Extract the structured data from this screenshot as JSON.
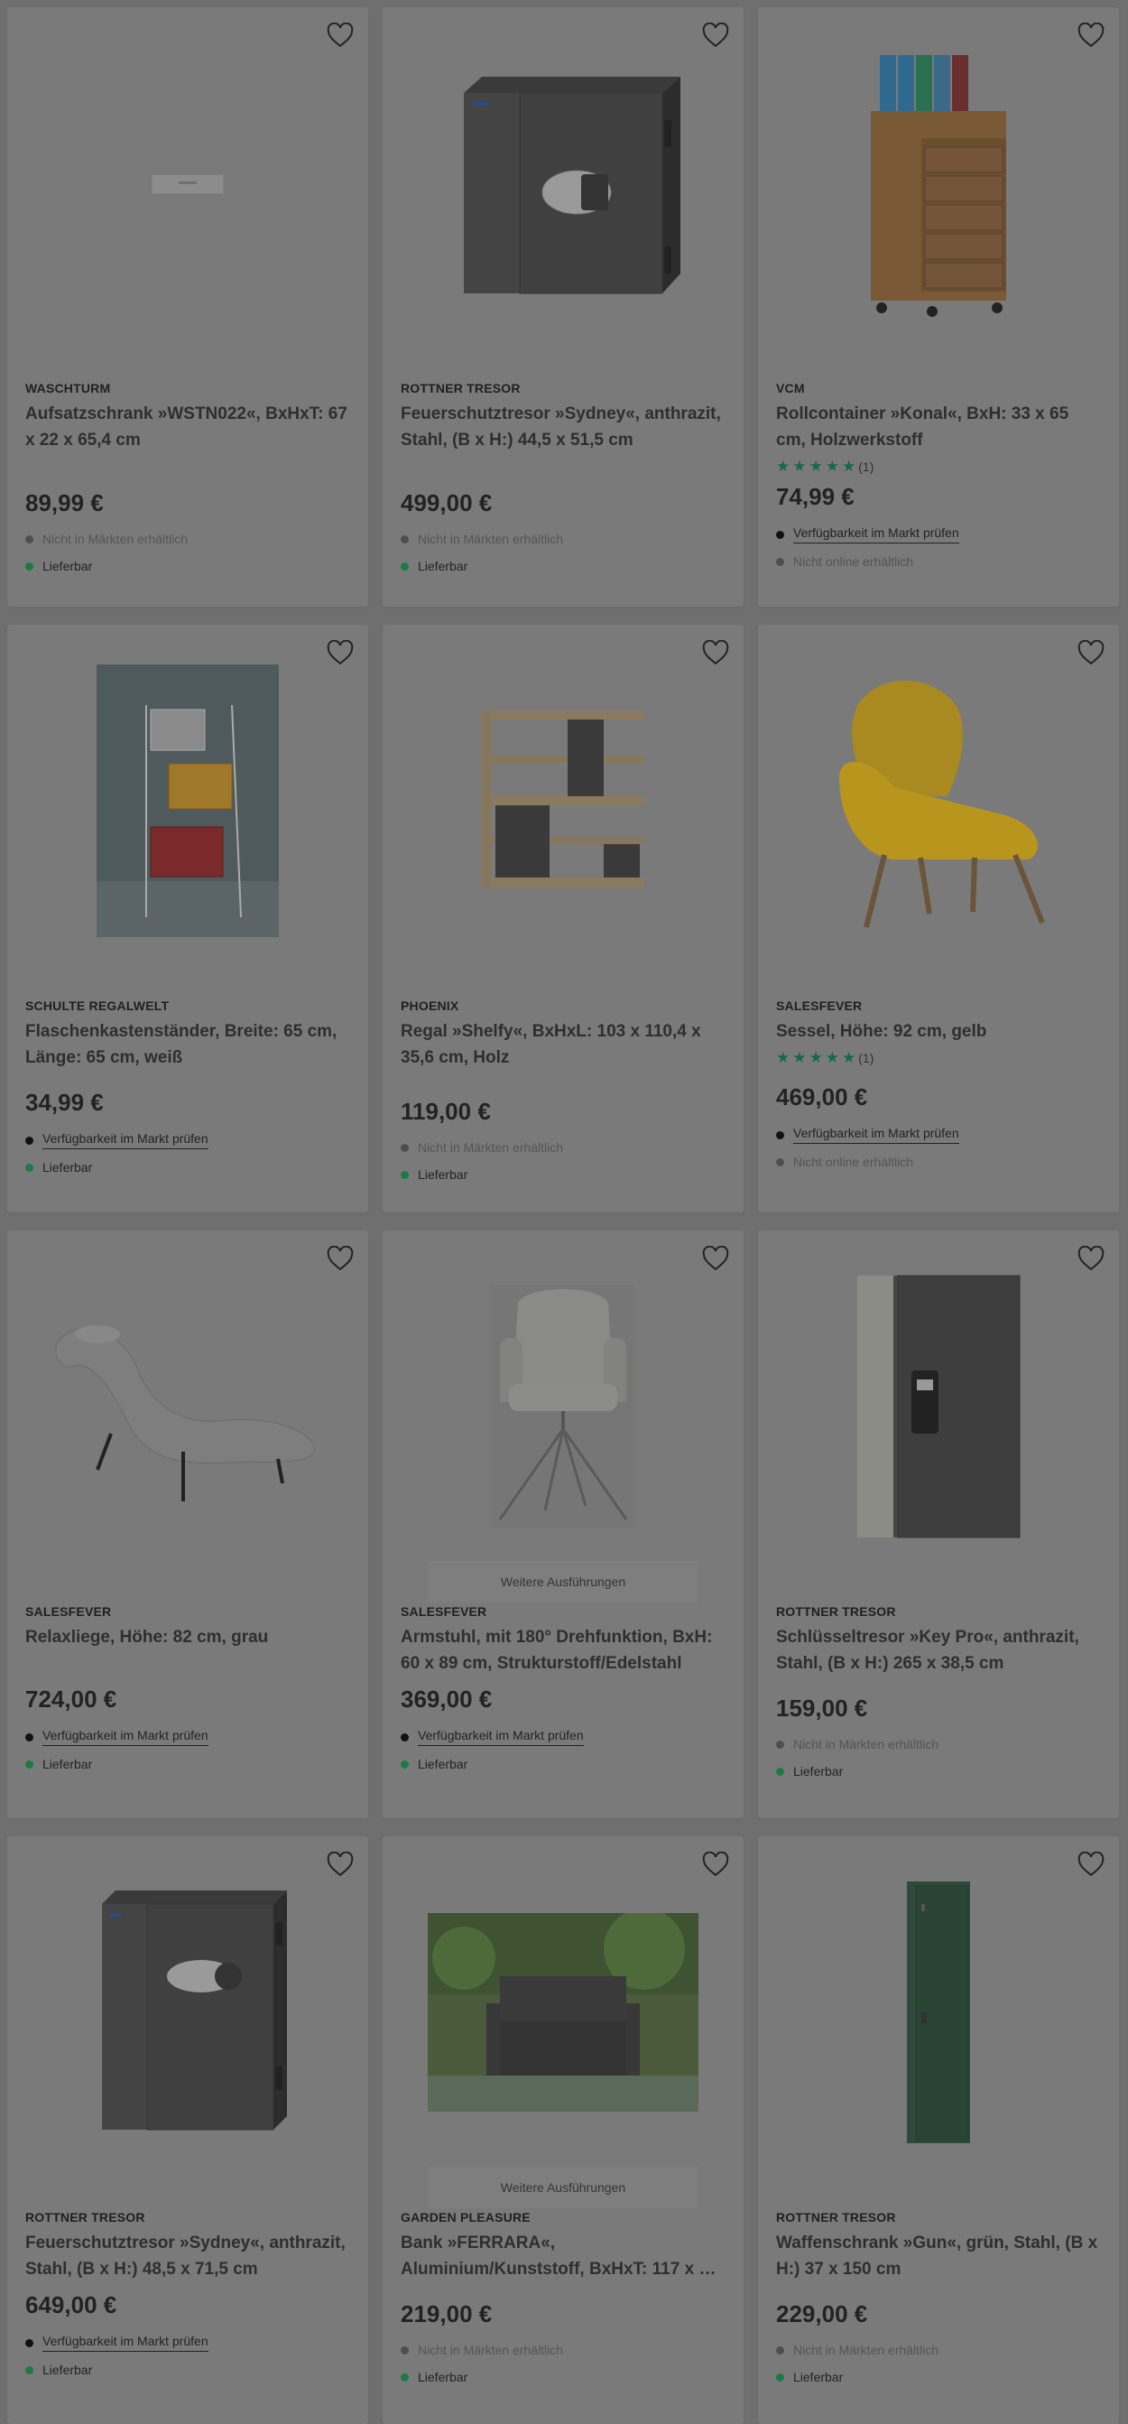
{
  "products": [
    {
      "brand": "WASCHTURM",
      "title": "Aufsatzschrank »WSTN022«, BxHxT: 67 x 22 x 65,4 cm",
      "price": "89,99 €",
      "store": "Nicht in Märkten erhältlich",
      "delivery": "Lieferbar",
      "image_icon": "wall-cabinet-image"
    },
    {
      "brand": "ROTTNER TRESOR",
      "title": "Feuerschutztresor »Sydney«, anthrazit, Stahl, (B x H:) 44,5 x 51,5 cm",
      "price": "499,00 €",
      "store": "Nicht in Märkten erhältlich",
      "delivery": "Lieferbar",
      "image_icon": "safe-image"
    },
    {
      "brand": "VCM",
      "title": "Rollcontainer »Konal«, BxH: 33 x 65 cm, Holzwerkstoff",
      "rating_count": "(1)",
      "rating_value": 5,
      "price": "74,99 €",
      "store": "Verfügbarkeit im Markt prüfen",
      "delivery": "Nicht online erhältlich",
      "image_icon": "rolling-container-image"
    },
    {
      "brand": "SCHULTE REGALWELT",
      "title": "Flaschenkastenständer, Breite: 65 cm, Länge: 65 cm, weiß",
      "price": "34,99 €",
      "store": "Verfügbarkeit im Markt prüfen",
      "delivery": "Lieferbar",
      "image_icon": "crate-stand-image"
    },
    {
      "brand": "PHOENIX",
      "title": "Regal »Shelfy«, BxHxL: 103 x 110,4 x 35,6 cm, Holz",
      "price": "119,00 €",
      "store": "Nicht in Märkten erhältlich",
      "delivery": "Lieferbar",
      "image_icon": "shelf-image"
    },
    {
      "brand": "SALESFEVER",
      "title": "Sessel, Höhe: 92 cm, gelb",
      "rating_count": "(1)",
      "rating_value": 5,
      "price": "469,00 €",
      "store": "Verfügbarkeit im Markt prüfen",
      "delivery": "Nicht online erhältlich",
      "image_icon": "armchair-image"
    },
    {
      "brand": "SALESFEVER",
      "title": "Relaxliege, Höhe: 82 cm, grau",
      "price": "724,00 €",
      "store": "Verfügbarkeit im Markt prüfen",
      "delivery": "Lieferbar",
      "image_icon": "lounger-image"
    },
    {
      "brand": "SALESFEVER",
      "title": "Armstuhl, mit 180° Drehfunktion, BxH: 60 x 89 cm, Strukturstoff/Edelstahl",
      "price": "369,00 €",
      "store": "Verfügbarkeit im Markt prüfen",
      "delivery": "Lieferbar",
      "variants": "Weitere Ausführungen",
      "image_icon": "swivel-chair-image"
    },
    {
      "brand": "ROTTNER TRESOR",
      "title": "Schlüsseltresor »Key Pro«, anthrazit, Stahl, (B x H:) 265 x 38,5 cm",
      "price": "159,00 €",
      "store": "Nicht in Märkten erhältlich",
      "delivery": "Lieferbar",
      "image_icon": "key-safe-image"
    },
    {
      "brand": "ROTTNER TRESOR",
      "title": "Feuerschutztresor »Sydney«, anthrazit, Stahl, (B x H:) 48,5 x 71,5 cm",
      "price": "649,00 €",
      "store": "Verfügbarkeit im Markt prüfen",
      "delivery": "Lieferbar",
      "image_icon": "tall-safe-image"
    },
    {
      "brand": "GARDEN PLEASURE",
      "title": "Bank »FERRARA«, Aluminium/Kunststoff, BxHxT: 117 x …",
      "price": "219,00 €",
      "store": "Nicht in Märkten erhältlich",
      "delivery": "Lieferbar",
      "variants": "Weitere Ausführungen",
      "image_icon": "garden-bench-image"
    },
    {
      "brand": "ROTTNER TRESOR",
      "title": "Waffenschrank »Gun«, grün, Stahl, (B x H:) 37 x 150 cm",
      "price": "229,00 €",
      "store": "Nicht in Märkten erhältlich",
      "delivery": "Lieferbar",
      "image_icon": "gun-cabinet-image"
    }
  ],
  "colors": {
    "overlay_bg": "#6f6f6f",
    "card_bg": "#7a7a7a",
    "star_green": "#146a46",
    "dot_green": "#1e7a45"
  }
}
